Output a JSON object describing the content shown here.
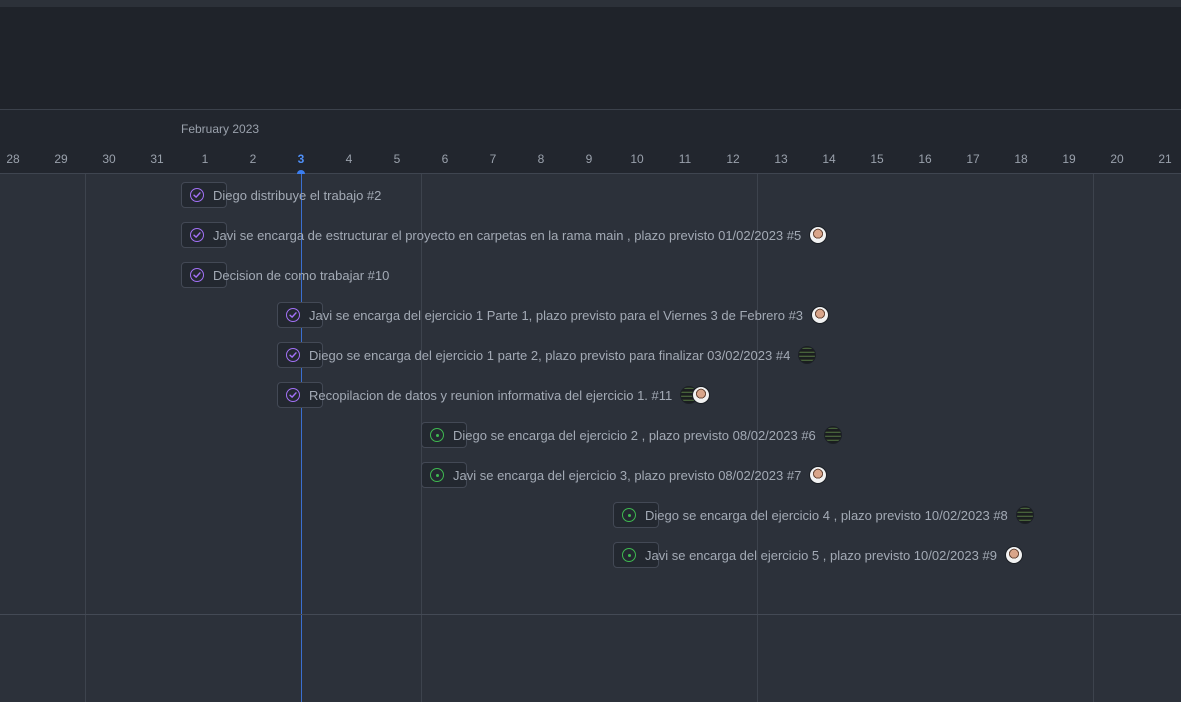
{
  "timeline": {
    "month_label": "February 2023",
    "today": "3",
    "days": [
      "28",
      "29",
      "30",
      "31",
      "1",
      "2",
      "3",
      "4",
      "5",
      "6",
      "7",
      "8",
      "9",
      "10",
      "11",
      "12",
      "13",
      "14",
      "15",
      "16",
      "17",
      "18",
      "19",
      "20",
      "21"
    ]
  },
  "colors": {
    "closed": "#a371f7",
    "open": "#3fb950",
    "today": "#3b7ef0"
  },
  "tasks": [
    {
      "title": "Diego distribuye el trabajo #2",
      "state": "closed",
      "assignees": []
    },
    {
      "title": "Javi se encarga de estructurar el proyecto en carpetas en la rama main , plazo previsto 01/02/2023 #5",
      "state": "closed",
      "assignees": [
        "javi-avatar"
      ]
    },
    {
      "title": "Decision de como trabajar #10",
      "state": "closed",
      "assignees": []
    },
    {
      "title": "Javi se encarga del ejercicio 1 Parte 1, plazo previsto para el Viernes 3 de Febrero #3",
      "state": "closed",
      "assignees": [
        "javi-avatar"
      ]
    },
    {
      "title": "Diego se encarga del ejercicio 1 parte 2, plazo previsto para finalizar 03/02/2023 #4",
      "state": "closed",
      "assignees": [
        "diego-avatar"
      ]
    },
    {
      "title": "Recopilacion de datos y reunion informativa del ejercicio 1. #11",
      "state": "closed",
      "assignees": [
        "diego-avatar",
        "javi-avatar"
      ]
    },
    {
      "title": "Diego se encarga del ejercicio 2 , plazo previsto 08/02/2023 #6",
      "state": "open",
      "assignees": [
        "diego-avatar"
      ]
    },
    {
      "title": "Javi se encarga del ejercicio 3, plazo previsto 08/02/2023 #7",
      "state": "open",
      "assignees": [
        "javi-avatar"
      ]
    },
    {
      "title": "Diego se encarga del ejercicio 4 , plazo previsto 10/02/2023 #8",
      "state": "open",
      "assignees": [
        "diego-avatar"
      ]
    },
    {
      "title": "Javi se encarga del ejercicio 5 , plazo previsto 10/02/2023 #9",
      "state": "open",
      "assignees": [
        "javi-avatar"
      ]
    }
  ]
}
